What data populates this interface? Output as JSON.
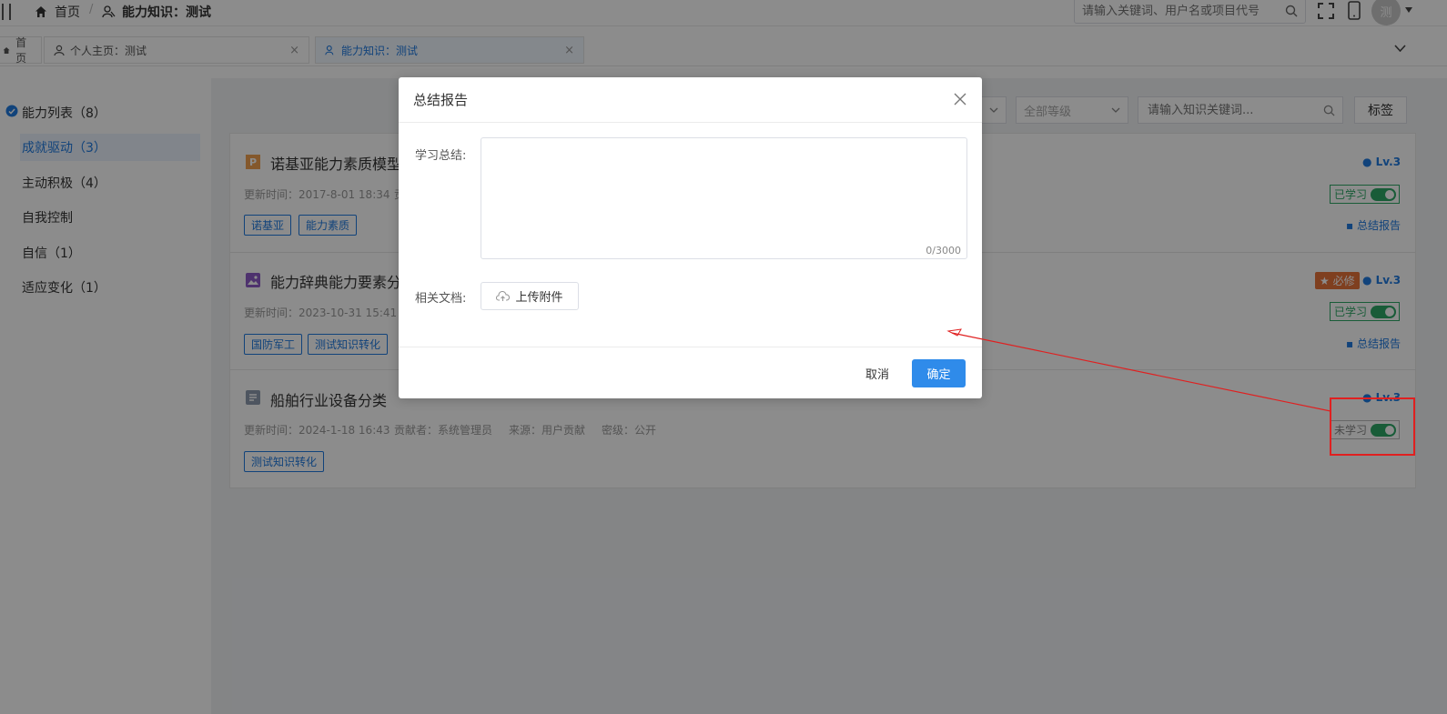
{
  "topbar": {
    "home_label": "首页",
    "separator": "/",
    "current_page": "能力知识：测试",
    "search_placeholder": "请输入关键词、用户名或项目代号",
    "avatar_text": "测"
  },
  "tabs": [
    {
      "label": "首页"
    },
    {
      "label": "个人主页：测试",
      "close": "×"
    },
    {
      "label": "能力知识：测试",
      "close": "×"
    }
  ],
  "sidebar": {
    "header": "能力列表（8）",
    "items": [
      {
        "label": "成就驱动（3）"
      },
      {
        "label": "主动积极（4）"
      },
      {
        "label": "自我控制"
      },
      {
        "label": "自信（1）"
      },
      {
        "label": "适应变化（1）"
      }
    ]
  },
  "filters": {
    "level_select": "全部等级",
    "search_placeholder": "请输入知识关键词...",
    "tag_button": "标签"
  },
  "knowledge_items": [
    {
      "badge_letter": "P",
      "title": "诺基亚能力素质模型",
      "updated": "更新时间：2017-8-01 18:34",
      "extra_meta": "贡",
      "tags": [
        "诺基亚",
        "能力素质"
      ],
      "level": "Lv.3",
      "status": "已学习",
      "report": "总结报告"
    },
    {
      "title": "能力辞典能力要素分",
      "updated": "更新时间：2023-10-31 15:41",
      "tags": [
        "国防军工",
        "测试知识转化"
      ],
      "required": "必修",
      "level": "Lv.3",
      "status": "已学习",
      "report": "总结报告"
    },
    {
      "title": "船舶行业设备分类",
      "updated": "更新时间：2024-1-18 16:43",
      "contributor": "贡献者：系统管理员",
      "source": "来源：用户贡献",
      "secrecy": "密级：公开",
      "tags": [
        "测试知识转化"
      ],
      "level": "Lv.3",
      "status": "未学习"
    }
  ],
  "dialog": {
    "title": "总结报告",
    "summary_label": "学习总结:",
    "char_count": "0/3000",
    "docs_label": "相关文档:",
    "upload_button": "上传附件",
    "cancel_button": "取消",
    "confirm_button": "确定"
  },
  "colors": {
    "primary": "#2f8bea",
    "success": "#2ea866",
    "required": "#e8733a",
    "annotation": "#e02020"
  }
}
